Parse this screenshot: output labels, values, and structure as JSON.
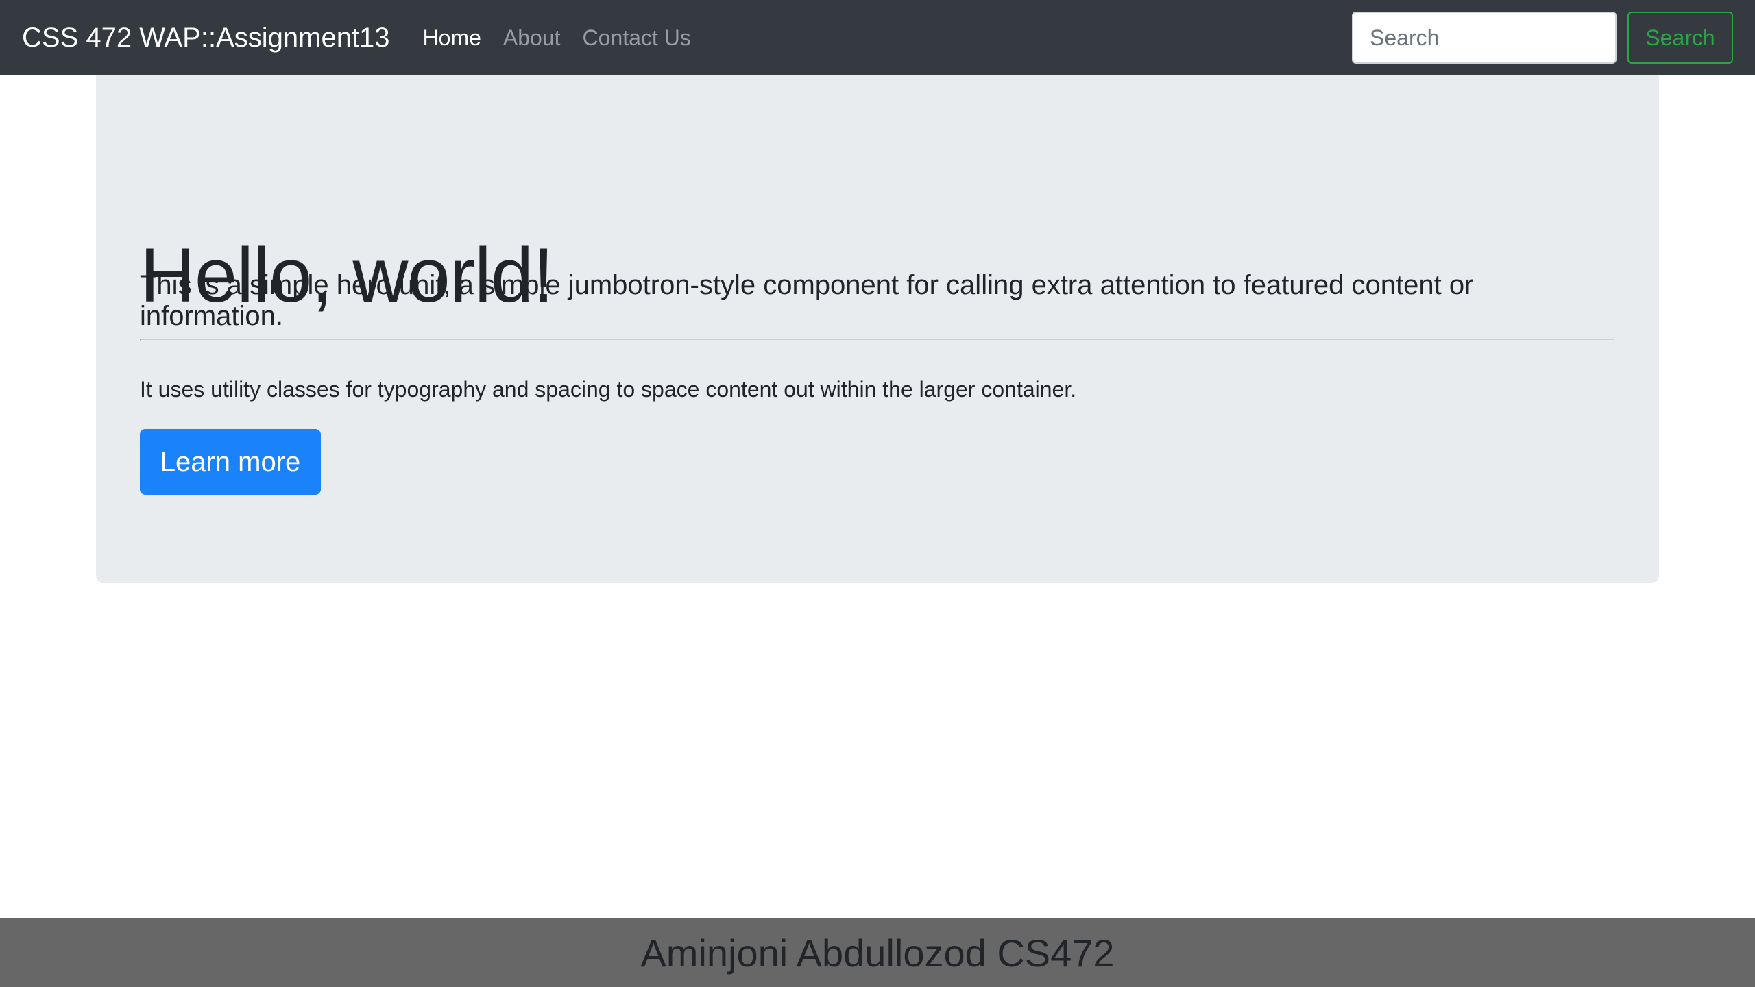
{
  "navbar": {
    "brand": "CSS 472 WAP::Assignment13",
    "links": [
      {
        "label": "Home",
        "active": true
      },
      {
        "label": "About",
        "active": false
      },
      {
        "label": "Contact Us",
        "active": false
      }
    ],
    "search": {
      "placeholder": "Search",
      "value": "",
      "button_label": "Search"
    }
  },
  "hero": {
    "title": "Hello, world!",
    "lead": "This is a simple hero unit, a simple jumbotron-style component for calling extra attention to featured content or information.",
    "body": "It uses utility classes for typography and spacing to space content out within the larger container.",
    "button_label": "Learn more"
  },
  "footer": {
    "text": "Aminjoni Abdullozod CS472"
  },
  "colors": {
    "navbar_bg": "#343a40",
    "jumbotron_bg": "#e9ecef",
    "primary": "#1a82fa",
    "success": "#28a745",
    "footer_bg": "#676767"
  }
}
